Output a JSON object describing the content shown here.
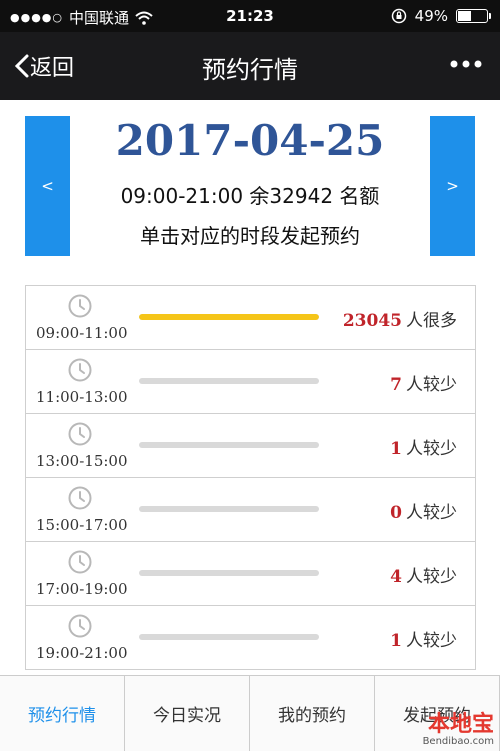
{
  "status_bar": {
    "carrier": "中国联通",
    "time": "21:23",
    "battery": "49%",
    "battery_level": 0.49
  },
  "nav": {
    "back_label": "返回",
    "title": "预约行情",
    "more_icon": "more-dots-icon"
  },
  "date": {
    "prev_label": "<",
    "next_label": ">",
    "title": "2017-04-25",
    "info": "09:00-21:00 余32942 名额",
    "hint": "单击对应的时段发起预约"
  },
  "slots": [
    {
      "time": "09:00-11:00",
      "count": "23045",
      "status": "人很多",
      "fill": 1.0
    },
    {
      "time": "11:00-13:00",
      "count": "7",
      "status": "人较少",
      "fill": 0
    },
    {
      "time": "13:00-15:00",
      "count": "1",
      "status": "人较少",
      "fill": 0
    },
    {
      "time": "15:00-17:00",
      "count": "0",
      "status": "人较少",
      "fill": 0
    },
    {
      "time": "17:00-19:00",
      "count": "4",
      "status": "人较少",
      "fill": 0
    },
    {
      "time": "19:00-21:00",
      "count": "1",
      "status": "人较少",
      "fill": 0
    }
  ],
  "tabs": [
    {
      "label": "预约行情",
      "active": true
    },
    {
      "label": "今日实况",
      "active": false
    },
    {
      "label": "我的预约",
      "active": false
    },
    {
      "label": "发起预约",
      "active": false
    }
  ],
  "watermark": {
    "main": "本地宝",
    "sub": "Bendibao.com"
  },
  "colors": {
    "accent": "#1e90ea",
    "date_title": "#2f5597",
    "count_red": "#c0242a",
    "bar_fill": "#f5c518",
    "bar_track": "#d9d9d9"
  }
}
